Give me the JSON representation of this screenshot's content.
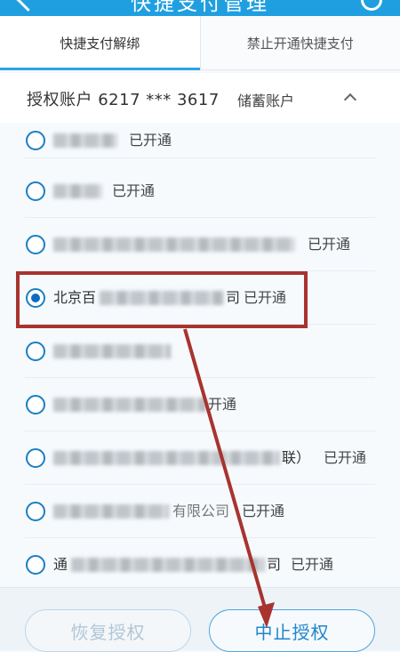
{
  "header": {
    "title": "快捷支付管理",
    "back_icon": "back-arrow-icon",
    "service_icon": "customer-service-icon"
  },
  "tabs": [
    {
      "label": "快捷支付解绑",
      "active": true
    },
    {
      "label": "禁止开通快捷支付",
      "active": false
    }
  ],
  "account": {
    "label": "授权账户 6217 *** 3617",
    "type": "储蓄账户",
    "toggle_icon": "chevron-up-icon"
  },
  "merchants": [
    {
      "prefix": "",
      "suffix": "",
      "status": "已开通",
      "selected": false
    },
    {
      "prefix": "",
      "suffix": "",
      "status": "已开通",
      "selected": false
    },
    {
      "prefix": "",
      "suffix": "",
      "status": "已开通",
      "selected": false
    },
    {
      "prefix": "北京百",
      "suffix": "司",
      "status": "已开通",
      "selected": true
    },
    {
      "prefix": "",
      "suffix": "",
      "status": "",
      "selected": false
    },
    {
      "prefix": "",
      "suffix": "",
      "status": "开通",
      "selected": false
    },
    {
      "prefix": "",
      "suffix": "联）",
      "status": "已开通",
      "selected": false
    },
    {
      "prefix": "",
      "suffix": "有限公司",
      "status": "已开通",
      "selected": false
    },
    {
      "prefix": "通",
      "suffix": "司",
      "status": "已开通",
      "selected": false
    }
  ],
  "buttons": {
    "restore": "恢复授权",
    "stop": "中止授权"
  },
  "colors": {
    "accent": "#2fa2e6",
    "annotation": "#a8332f",
    "selected_radio": "#0d6cc0"
  }
}
